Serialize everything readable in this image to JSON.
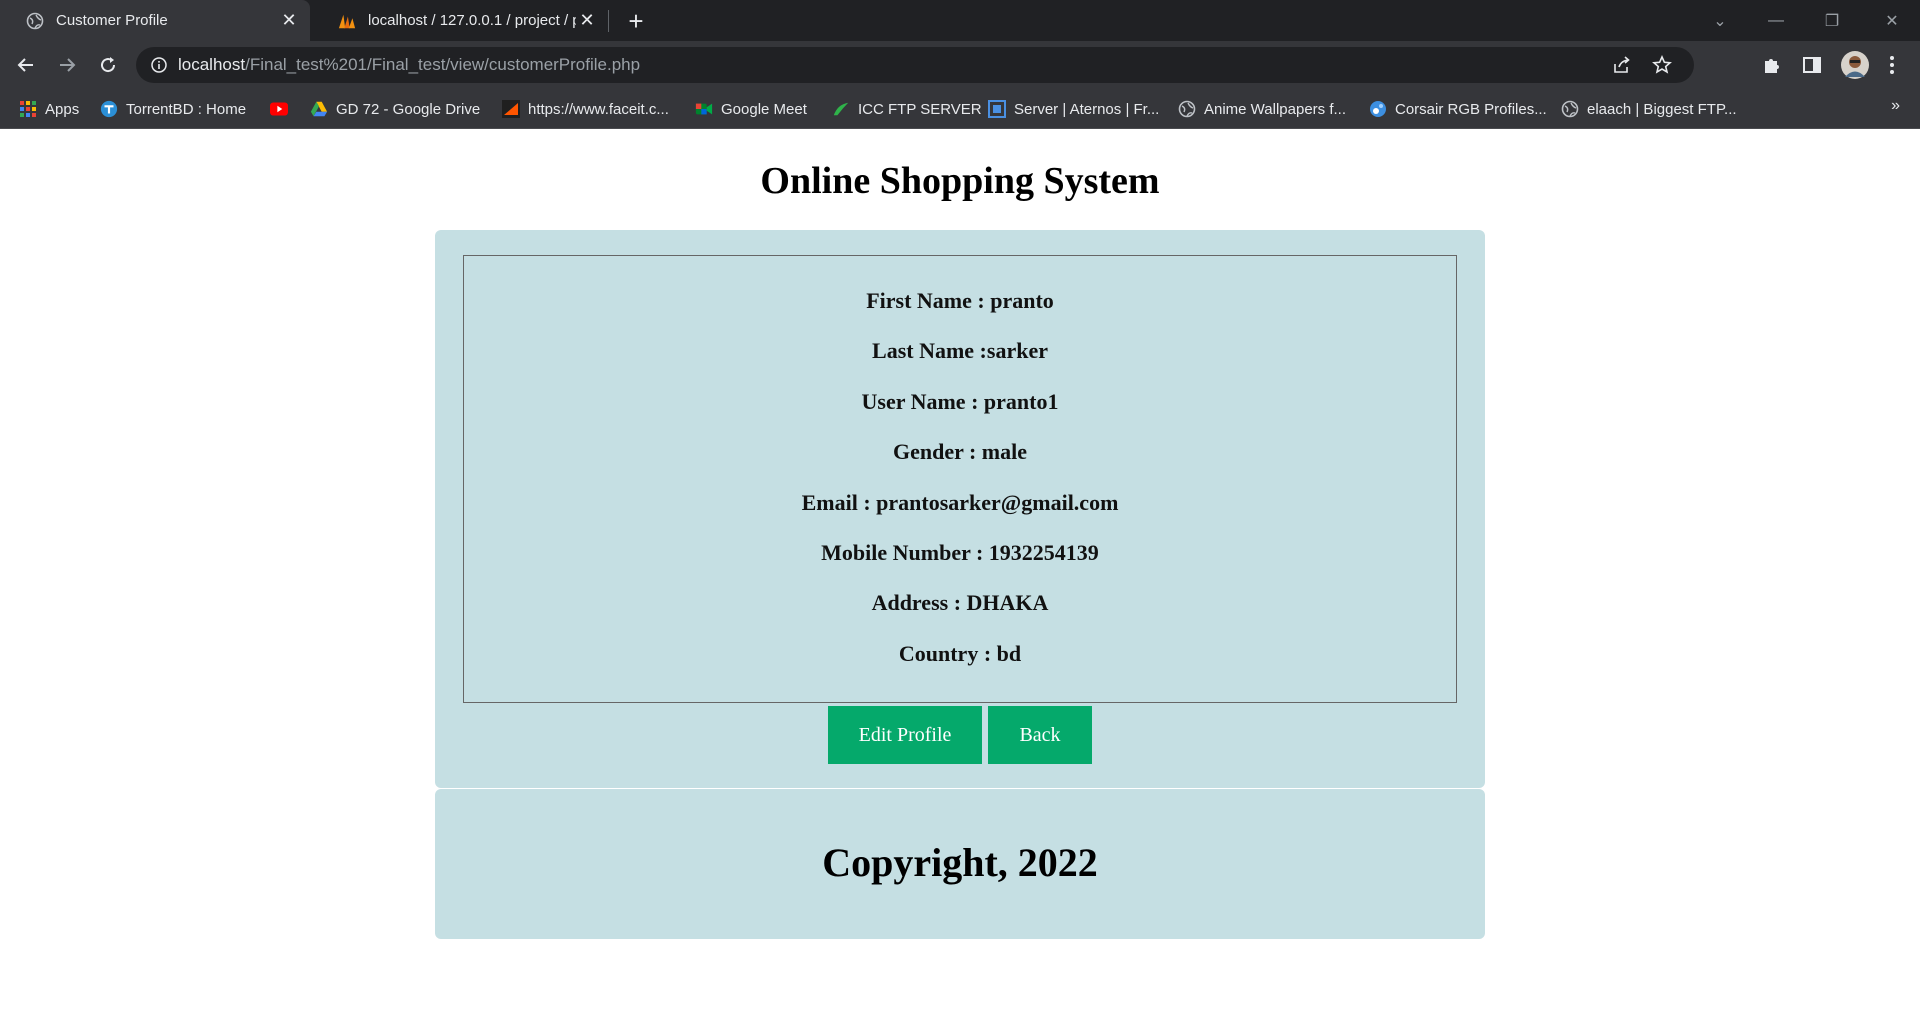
{
  "browser": {
    "tabs": [
      {
        "title": "Customer Profile",
        "active": true,
        "icon": "globe-icon"
      },
      {
        "title": "localhost / 127.0.0.1 / project / p",
        "active": false,
        "icon": "phpmyadmin-icon"
      }
    ],
    "url": {
      "host": "localhost",
      "path": "/Final_test%201/Final_test/view/customerProfile.php"
    },
    "bookmarks": [
      {
        "label": "Apps",
        "icon": "apps-grid-icon"
      },
      {
        "label": "TorrentBD : Home",
        "icon": "torrentbd-icon"
      },
      {
        "label": "",
        "icon": "youtube-icon"
      },
      {
        "label": "GD 72 - Google Drive",
        "icon": "google-drive-icon"
      },
      {
        "label": "https://www.faceit.c...",
        "icon": "faceit-icon"
      },
      {
        "label": "Google Meet",
        "icon": "google-meet-icon"
      },
      {
        "label": "ICC FTP SERVER",
        "icon": "ftp-leaf-icon"
      },
      {
        "label": "Server | Aternos | Fr...",
        "icon": "aternos-icon"
      },
      {
        "label": "Anime Wallpapers f...",
        "icon": "globe-icon"
      },
      {
        "label": "Corsair RGB Profiles...",
        "icon": "corsair-icon"
      },
      {
        "label": "elaach | Biggest FTP...",
        "icon": "globe-icon"
      }
    ],
    "bookmarks_more": "»"
  },
  "page": {
    "site_title": "Online Shopping System",
    "profile_lines": [
      "First Name : pranto",
      "Last Name :sarker",
      "User Name : pranto1",
      "Gender : male",
      "Email : prantosarker@gmail.com",
      "Mobile Number : 1932254139",
      "Address : DHAKA",
      "Country : bd"
    ],
    "buttons": {
      "edit": "Edit Profile",
      "back": "Back"
    },
    "footer": "Copyright, 2022"
  },
  "colors": {
    "panel": "#c5dfe3",
    "button": "#05a96b",
    "chrome_dark": "#202124",
    "chrome": "#35363a"
  }
}
